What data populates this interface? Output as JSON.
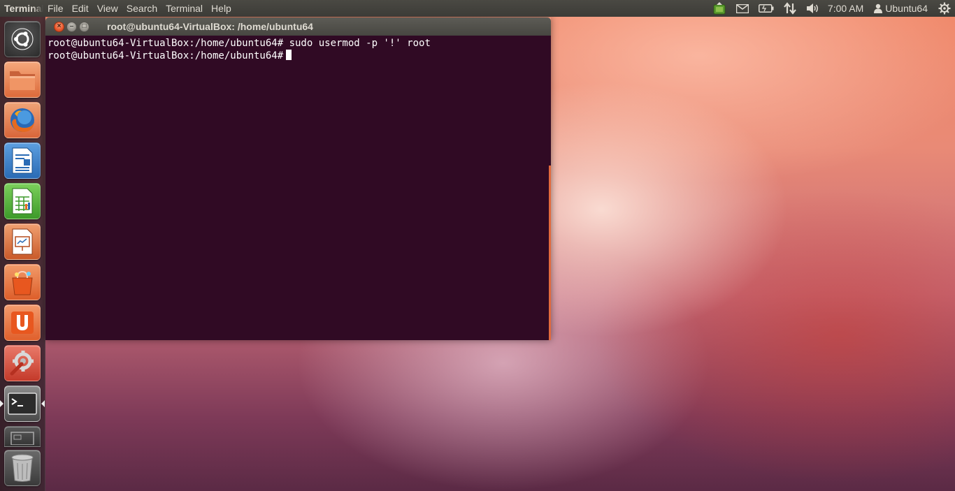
{
  "panel": {
    "app_name": "Terminal",
    "menus": [
      "File",
      "Edit",
      "View",
      "Search",
      "Terminal",
      "Help"
    ],
    "clock": "7:00 AM",
    "user": "Ubuntu64",
    "indicator_icons": [
      "update-manager-icon",
      "mail-icon",
      "battery-icon",
      "network-icon",
      "volume-icon",
      "user-icon",
      "session-gear-icon"
    ]
  },
  "launcher": {
    "items": [
      "Dash Home",
      "Files",
      "Firefox Web Browser",
      "LibreOffice Writer",
      "LibreOffice Calc",
      "LibreOffice Impress",
      "Ubuntu Software Center",
      "Ubuntu One",
      "System Settings",
      "Terminal",
      "Workspace Switcher",
      "Trash"
    ],
    "active_item": "Terminal"
  },
  "window": {
    "title": "root@ubuntu64-VirtualBox: /home/ubuntu64",
    "buttons": {
      "close": "×",
      "minimize": "–",
      "maximize": "□"
    }
  },
  "terminal": {
    "lines": [
      "root@ubuntu64-VirtualBox:/home/ubuntu64# sudo usermod -p '!' root",
      "root@ubuntu64-VirtualBox:/home/ubuntu64#"
    ]
  },
  "colors": {
    "terminal_bg": "#300a24",
    "panel_bg": "#3c3b37",
    "accent": "#e95420"
  }
}
